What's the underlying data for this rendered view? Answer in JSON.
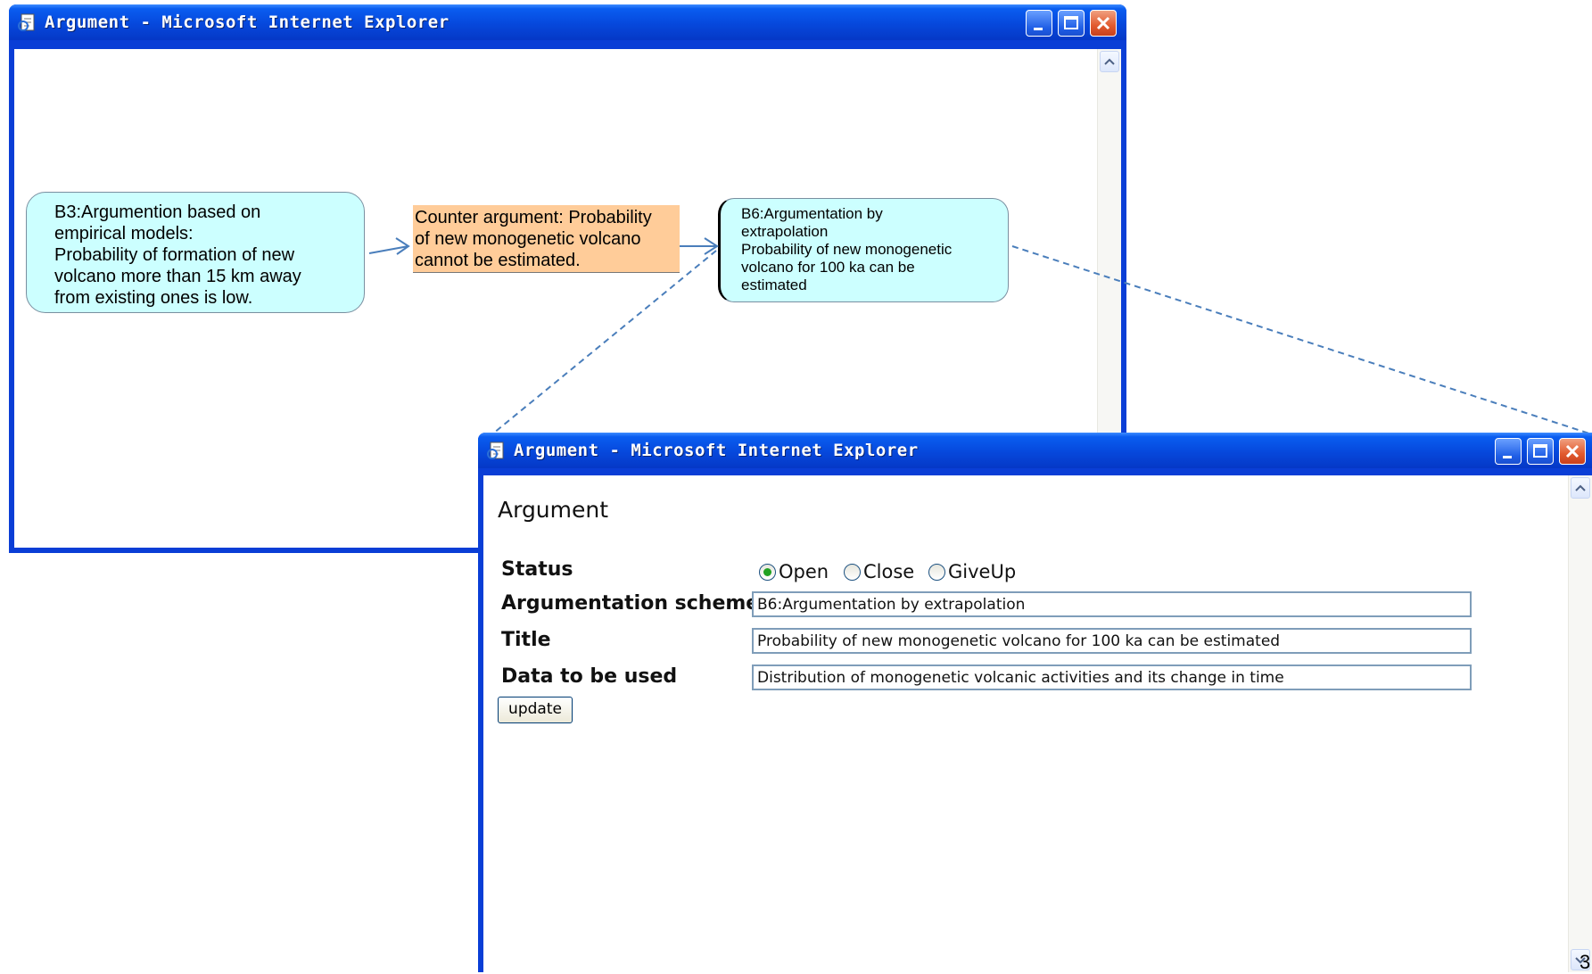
{
  "window_back": {
    "title": "Argument - Microsoft Internet Explorer",
    "nodes": {
      "b3": {
        "lines": [
          "B3:Argumention based on",
          "empirical models:",
          "Probability of formation of new",
          "volcano more than 15 km away",
          "from existing ones  is low."
        ]
      },
      "counter": {
        "lines": [
          "Counter argument: Probability",
          "of new monogenetic volcano",
          "cannot be estimated."
        ]
      },
      "b6": {
        "lines": [
          "B6:Argumentation by",
          "extrapolation",
          "Probability of new monogenetic",
          "volcano  for 100 ka can be",
          "estimated"
        ]
      }
    }
  },
  "window_front": {
    "title": "Argument - Microsoft Internet Explorer",
    "heading": "Argument",
    "status_label": "Status",
    "status_options": [
      "Open",
      "Close",
      "GiveUp"
    ],
    "status_selected": "Open",
    "scheme_label": "Argumentation scheme",
    "scheme_value": "B6:Argumentation by extrapolation",
    "title_label": "Title",
    "title_value": "Probability of new monogenetic volcano for 100 ka can be estimated",
    "data_label": "Data to be used",
    "data_value": "Distribution of monogenetic volcanic activities and its change in time",
    "update_button": "update"
  },
  "page_number": "3",
  "colors": {
    "xp_blue": "#0a3ed6",
    "node_cyan": "#ccffff",
    "counter_orange": "#ffcc99",
    "connector_blue": "#4a7ebb",
    "radio_green": "#21a121",
    "input_border": "#7f9db9"
  }
}
